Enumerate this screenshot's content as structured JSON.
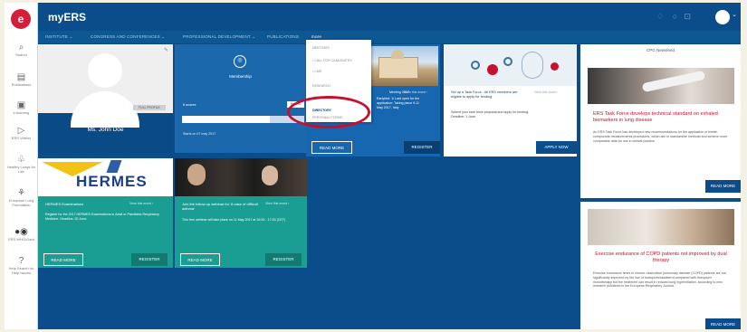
{
  "app": {
    "brand": "myERS",
    "logo_letter": "e"
  },
  "sidebar": {
    "items": [
      {
        "icon": "search-icon",
        "glyph": "⌕",
        "label": "Search"
      },
      {
        "icon": "publications-icon",
        "glyph": "▤",
        "label": "Publications"
      },
      {
        "icon": "elearning-icon",
        "glyph": "▣",
        "label": "e-learning"
      },
      {
        "icon": "video-icon",
        "glyph": "▷",
        "label": "ERS Videos"
      },
      {
        "icon": "lungs-icon",
        "glyph": "♧",
        "label": "Healthy Lungs for Life"
      },
      {
        "icon": "foundation-icon",
        "glyph": "⚘",
        "label": "European Lung Foundation"
      },
      {
        "icon": "ers-who-icon",
        "glyph": "●◉",
        "label": "ERS WHO/Gard"
      },
      {
        "icon": "help-icon",
        "glyph": "?",
        "label": "Help Search for Help Issues"
      }
    ]
  },
  "header": {
    "icons": [
      "bell-icon",
      "settings-icon",
      "cart-icon"
    ],
    "glyphs": [
      "♢",
      "○",
      "⊡"
    ]
  },
  "nav": {
    "items": [
      "INSTITUTE ⌄",
      "CONGRESS AND CONFERENCES ⌄",
      "PROFESSIONAL DEVELOPMENT ⌄",
      "PUBLICATIONS",
      "more"
    ]
  },
  "dropdown": {
    "items": [
      "MEETINGS",
      "• CALL FOR CANDIDATES",
      "• CME",
      "RESEARCH",
      "ADVOCACY",
      "DIRECTORY",
      "PERSONAL FORMS"
    ]
  },
  "profile": {
    "name": "Ms. John Doe",
    "full_profile": "FULL PROFILE",
    "edit_icon": "✎"
  },
  "membership": {
    "title": "Membership",
    "left_text": "6 scores",
    "right_text": "Renew",
    "progress": 0.72,
    "status": "Starts on 07 may 2017"
  },
  "city_card": {
    "meta": "View this event ›",
    "line1": "Meeting 2017",
    "line2": "Earlybird: 1/ Last open for the",
    "line3": "application: Taking place 9-11",
    "line4": "May 2017, Italy",
    "read_more": "READ MORE",
    "register": "REGISTER"
  },
  "science_card": {
    "title": "Set up a Task Force - All ERS members are eligible to apply for funding",
    "body": "Submit your task force proposal and apply for funding. Deadline: 1 June.",
    "meta": "View this event ›",
    "apply": "APPLY NOW"
  },
  "hermes_card": {
    "logo": "HERMES",
    "title": "HERMES Examinations",
    "meta": "View this event ›",
    "body": "Register for the 2017 HERMES Examinations in Adult or Paediatric Respiratory Medicine. Deadline: 30 June.",
    "read_more": "READ MORE",
    "register": "REGISTER"
  },
  "webinar_card": {
    "title": "Join the follow-up webinar for 'A case of difficult asthma'",
    "meta": "View this event ›",
    "body": "This free webinar will take place on 11 May 2017 at 16:00 - 17:00 (CET)",
    "read_more": "READ MORE",
    "register": "REGISTER"
  },
  "right_panel": {
    "header": "CPG Newsfeed",
    "article1": {
      "title": "ERS Task Force develops technical standard on exhaled biomarkers in lung disease",
      "body": "An ERS Task Force has developed new recommendations for the application of breath compounds measurements procedures, which aim to standardise methods and achieve more comparable data for use in clinical practice.",
      "read_more": "READ MORE"
    },
    "article2": {
      "title": "Exercise endurance of COPD patients not improved by dual therapy",
      "body": "Exercise endurance times in chronic obstructive pulmonary disease (COPD) patients are not significantly improved by the use of tiotropium/olodaterol compared with tiotropium monotherapy but the treatment can result in reduced lung hyperinflation, according to new research published in the European Respiratory Journal.",
      "read_more": "READ MORE"
    }
  },
  "colors": {
    "dark_blue": "#0a4d8a",
    "teal": "#1a9e93",
    "red": "#c8102e"
  }
}
